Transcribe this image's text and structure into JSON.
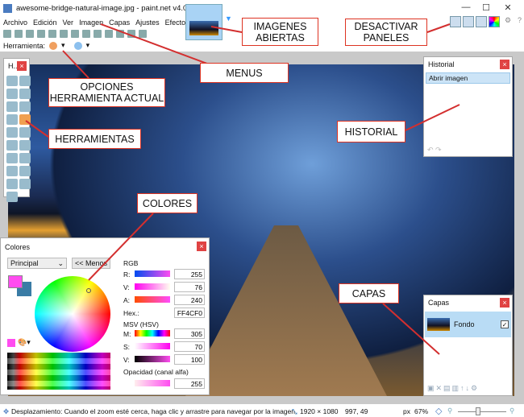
{
  "window": {
    "title": "awesome-bridge-natural-image.jpg - paint.net v4.0.19"
  },
  "menu": [
    "Archivo",
    "Edición",
    "Ver",
    "Imagen",
    "Capas",
    "Ajustes",
    "Efectos"
  ],
  "tool_options": {
    "label": "Herramienta:"
  },
  "tools_panel": {
    "title": "H..."
  },
  "history": {
    "title": "Historial",
    "items": [
      "Abrir imagen"
    ]
  },
  "layers": {
    "title": "Capas",
    "items": [
      {
        "name": "Fondo",
        "visible": true
      }
    ]
  },
  "colors": {
    "title": "Colores",
    "mode": "Principal",
    "less_button": "<< Menos",
    "rgb_label": "RGB",
    "r_label": "R:",
    "r": "255",
    "g_label": "V:",
    "g": "76",
    "b_label": "A:",
    "b": "240",
    "hex_label": "Hex.:",
    "hex": "FF4CF0",
    "hsv_label": "MSV (HSV)",
    "h_label": "M:",
    "h": "305",
    "s_label": "S:",
    "s": "70",
    "v_label": "V:",
    "v": "100",
    "alpha_label": "Opacidad (canal alfa)",
    "alpha": "255",
    "primary": "#FF4CF0",
    "secondary": "#3A7CA5"
  },
  "status": {
    "hint": "Desplazamiento: Cuando el zoom esté cerca, haga clic y arrastre para navegar por la imagen.",
    "size": "1920 × 1080",
    "pos": "997, 49",
    "unit": "px",
    "zoom": "67%"
  },
  "annotations": {
    "imagenes": "IMAGENES ABIERTAS",
    "paneles": "DESACTIVAR PANELES",
    "menus": "MENUS",
    "opciones": "OPCIONES HERRAMIENTA ACTUAL",
    "herramientas": "HERRAMIENTAS",
    "historial": "HISTORIAL",
    "colores": "COLORES",
    "capas": "CAPAS"
  },
  "accent": "#D32F2F"
}
